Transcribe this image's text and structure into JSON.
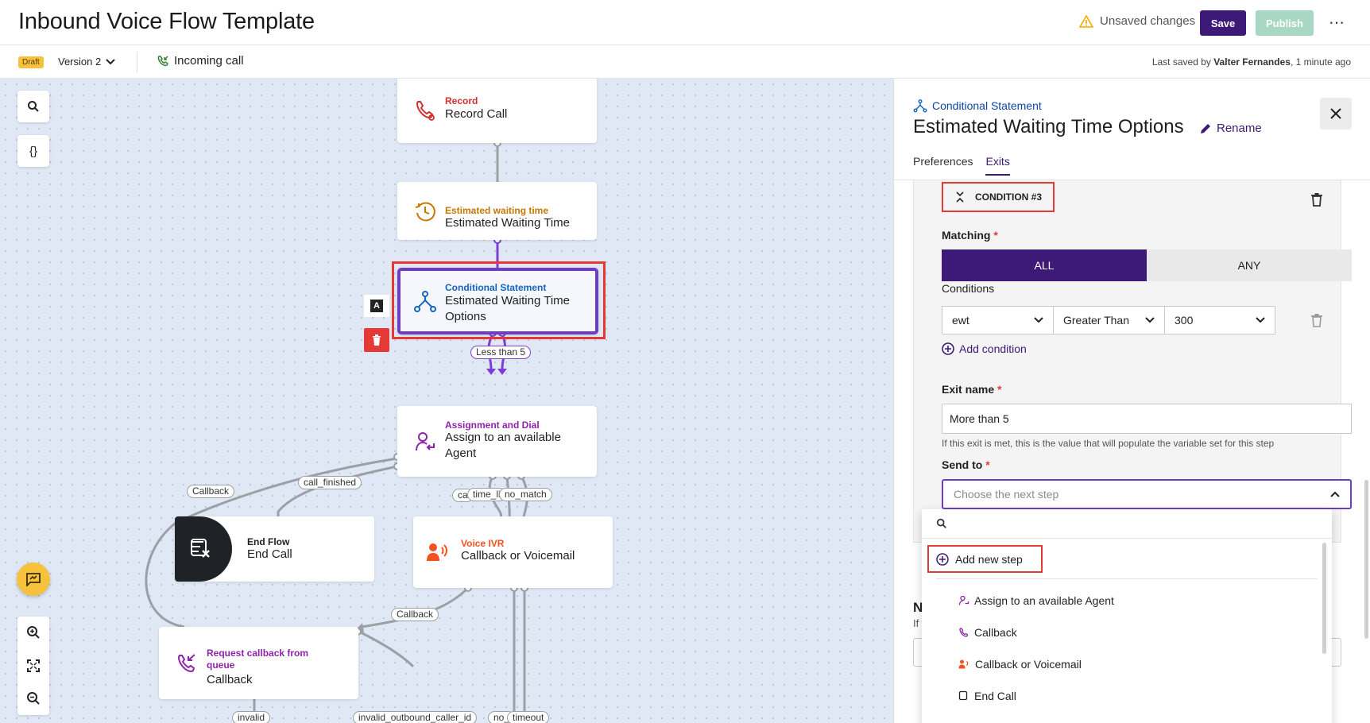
{
  "header": {
    "title": "Inbound Voice Flow Template",
    "unsaved": "Unsaved changes",
    "save_label": "Save",
    "publish_label": "Publish",
    "more": "⋯"
  },
  "subheader": {
    "status": "Draft",
    "version": "Version 2",
    "trigger": "Incoming call",
    "last_saved_prefix": "Last saved by",
    "last_saved_user": "Valter Fernandes",
    "last_saved_time": ", 1 minute ago"
  },
  "canvas": {
    "tools": {
      "search": "⌕",
      "variables": "{}"
    },
    "nodes": {
      "record": {
        "type": "Record",
        "name": "Record Call",
        "color": "#d32f2f"
      },
      "ewt": {
        "type": "Estimated waiting time",
        "name": "Estimated Waiting Time",
        "color": "#c77800"
      },
      "cond": {
        "type": "Conditional Statement",
        "name": "Estimated Waiting Time Options",
        "color": "#1565c0"
      },
      "assign": {
        "type": "Assignment and Dial",
        "name": "Assign to an available Agent",
        "color": "#8e24aa"
      },
      "endflow": {
        "type": "End Flow",
        "name": "End Call"
      },
      "ivr": {
        "type": "Voice IVR",
        "name": "Callback or Voicemail",
        "color": "#f4511e"
      },
      "callback": {
        "type": "Request callback from queue",
        "name": "Callback",
        "color": "#8e24aa"
      }
    },
    "edge_labels": {
      "less_than_5": "Less than 5",
      "callback_a": "Callback",
      "call_finished": "call_finished",
      "ca": "ca",
      "time_li": "time_li",
      "no_match": "no_match",
      "callback_b": "Callback",
      "invalid": "invalid",
      "invalid_outbound": "invalid_outbound_caller_id",
      "no": "no_",
      "timeout": "timeout"
    },
    "node_actions": {
      "label_toggle": "A"
    }
  },
  "panel": {
    "type": "Conditional Statement",
    "title": "Estimated Waiting Time Options",
    "rename": "Rename",
    "tabs": [
      "Preferences",
      "Exits"
    ],
    "active_tab": "Exits",
    "condition": {
      "heading": "CONDITION #3",
      "matching_label": "Matching",
      "required_mark": "*",
      "matching_options": [
        "ALL",
        "ANY"
      ],
      "matching_selected": "ALL",
      "conditions_label": "Conditions",
      "variable": "ewt",
      "operator": "Greater Than",
      "value": "300",
      "add_condition": "Add condition",
      "exit_name_label": "Exit name",
      "exit_name_value": "More than 5",
      "exit_help": "If this exit is met, this is the value that will populate the variable set for this step",
      "send_to_label": "Send to",
      "send_to_placeholder": "Choose the next step"
    },
    "dropdown": {
      "add_new": "Add new step",
      "items": [
        "Assign to an available Agent",
        "Callback",
        "Callback or Voicemail",
        "End Call"
      ]
    },
    "below": {
      "heading": "N",
      "text": "If"
    }
  },
  "colors": {
    "brand": "#3d1a78",
    "highlight": "#e53935",
    "canvas_bg": "#dfe8f4",
    "selected_border": "#6f3cc4"
  }
}
